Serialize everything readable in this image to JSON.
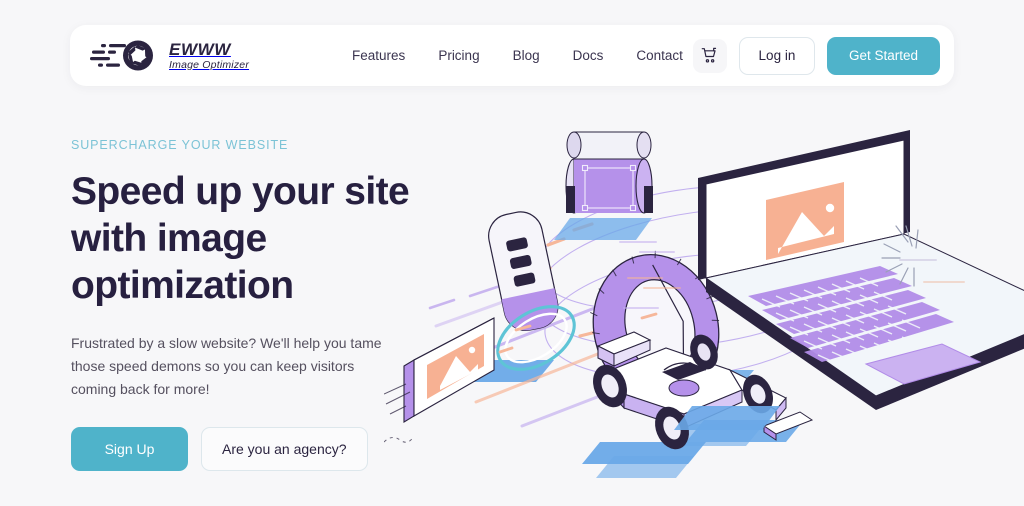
{
  "brand": {
    "name": "EWWW",
    "tagline": "Image Optimizer",
    "logo_icon": "camera-aperture-speed-icon",
    "accent_color": "#4fb3ca",
    "headline_color": "#272040",
    "page_background": "#f7f7f9"
  },
  "nav": {
    "items": [
      {
        "label": "Features"
      },
      {
        "label": "Pricing"
      },
      {
        "label": "Blog"
      },
      {
        "label": "Docs"
      },
      {
        "label": "Contact"
      }
    ]
  },
  "header_actions": {
    "cart_icon": "shopping-cart-icon",
    "login_label": "Log in",
    "get_started_label": "Get Started"
  },
  "hero": {
    "eyebrow": "SUPERCHARGE YOUR WEBSITE",
    "eyebrow_color": "#7cc3d6",
    "headline": "Speed up your site with image optimization",
    "subcopy": "Frustrated by a slow website? We'll help you tame those speed demons so you can keep visitors coming back for more!",
    "primary_cta": "Sign Up",
    "secondary_cta": "Are you an agency?"
  },
  "illustration": {
    "name": "isometric-speed-image-optimization-illustration",
    "elements": [
      "laptop-with-image-placeholder",
      "formula-one-race-car",
      "floating-image-card",
      "purple-tire-ring",
      "purple-cylinder-roller",
      "speed-swirl-lines",
      "blue-ground-bars"
    ],
    "colors": {
      "purple": "#b18ce8",
      "lavender": "#cdb4f2",
      "peach": "#f7b193",
      "blue": "#64a8e8",
      "dark": "#2b2440",
      "teal": "#4fb3ca"
    }
  }
}
